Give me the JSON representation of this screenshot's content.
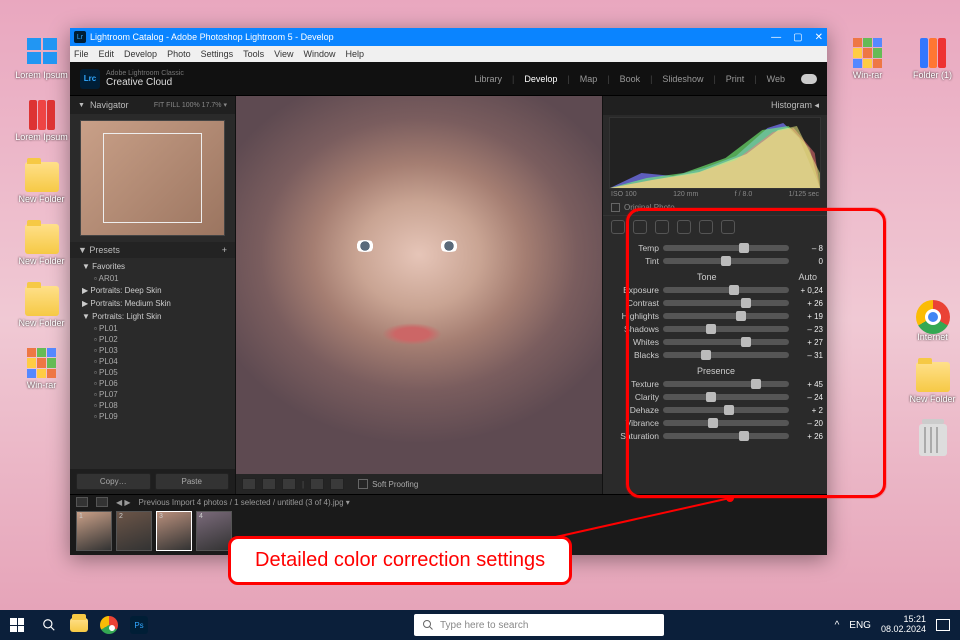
{
  "desktop": {
    "left": [
      {
        "label": "Lorem Ipsum",
        "type": "flag"
      },
      {
        "label": "Lorem Ipsum",
        "type": "binder-red"
      },
      {
        "label": "New Folder",
        "type": "folder"
      },
      {
        "label": "New Folder",
        "type": "folder"
      },
      {
        "label": "New Folder",
        "type": "folder"
      },
      {
        "label": "Win-rar",
        "type": "winrar"
      }
    ],
    "right": [
      {
        "label": "Win-rar",
        "type": "winrar"
      },
      {
        "label": "Folder (1)",
        "type": "binder-mix"
      },
      {
        "label": "Internet",
        "type": "chrome"
      },
      {
        "label": "New Folder",
        "type": "folder"
      },
      {
        "label": "",
        "type": "trash"
      }
    ]
  },
  "titlebar": {
    "text": "Lightroom Catalog - Adobe Photoshop Lightroom 5      - Develop",
    "icon": "Lr"
  },
  "menubar": [
    "File",
    "Edit",
    "Develop",
    "Photo",
    "Settings",
    "Tools",
    "View",
    "Window",
    "Help"
  ],
  "header": {
    "brand_icon": "Lrc",
    "brand_line1": "Adobe Lightroom Classic",
    "brand_line2": "Creative Cloud",
    "modules": [
      "Library",
      "Develop",
      "Map",
      "Book",
      "Slideshow",
      "Print",
      "Web"
    ],
    "active_module": "Develop"
  },
  "navigator": {
    "title": "Navigator",
    "meta": "FIT   FILL   100%   17.7% ▾"
  },
  "presets": {
    "title": "Presets",
    "plus": "+",
    "groups": [
      {
        "name": "Favorites",
        "open": true,
        "items": [
          "AR01"
        ]
      },
      {
        "name": "Portraits: Deep Skin",
        "open": false,
        "items": []
      },
      {
        "name": "Portraits: Medium Skin",
        "open": false,
        "items": []
      },
      {
        "name": "Portraits: Light Skin",
        "open": true,
        "items": [
          "PL01",
          "PL02",
          "PL03",
          "PL04",
          "PL05",
          "PL06",
          "PL07",
          "PL08",
          "PL09"
        ]
      }
    ],
    "copy": "Copy…",
    "paste": "Paste"
  },
  "histogram": {
    "title": "Histogram ◂",
    "meta": [
      "ISO 100",
      "120 mm",
      "f / 8.0",
      "1/125 sec"
    ],
    "original": "Original Photo"
  },
  "wb": {
    "temp": {
      "label": "Temp",
      "value": "– 8",
      "pos": 64
    },
    "tint": {
      "label": "Tint",
      "value": "0",
      "pos": 50
    }
  },
  "tone": {
    "title": "Tone",
    "auto": "Auto",
    "exposure": {
      "label": "Exposure",
      "value": "+ 0,24",
      "pos": 56
    },
    "contrast": {
      "label": "Contrast",
      "value": "+ 26",
      "pos": 66
    },
    "highlights": {
      "label": "Highlights",
      "value": "+ 19",
      "pos": 62
    },
    "shadows": {
      "label": "Shadows",
      "value": "– 23",
      "pos": 38
    },
    "whites": {
      "label": "Whites",
      "value": "+ 27",
      "pos": 66
    },
    "blacks": {
      "label": "Blacks",
      "value": "– 31",
      "pos": 34
    }
  },
  "presence": {
    "title": "Presence",
    "texture": {
      "label": "Texture",
      "value": "+ 45",
      "pos": 74
    },
    "clarity": {
      "label": "Clarity",
      "value": "– 24",
      "pos": 38
    },
    "dehaze": {
      "label": "Dehaze",
      "value": "+ 2",
      "pos": 52
    },
    "vibrance": {
      "label": "Vibrance",
      "value": "– 20",
      "pos": 40
    },
    "saturation": {
      "label": "Saturation",
      "value": "+ 26",
      "pos": 64
    }
  },
  "toolbar": {
    "soft_proofing": "Soft Proofing"
  },
  "filmstrip": {
    "info": "Previous Import    4 photos / 1 selected / untitled (3 of 4).jpg ▾",
    "nav": "◀ ▶",
    "count": 4,
    "selected": 3
  },
  "callout": {
    "label": "Detailed color correction settings"
  },
  "taskbar": {
    "search_placeholder": "Type here to search",
    "lang": "ENG",
    "time": "15:21",
    "date": "08.02.2024",
    "tray_up": "^"
  }
}
